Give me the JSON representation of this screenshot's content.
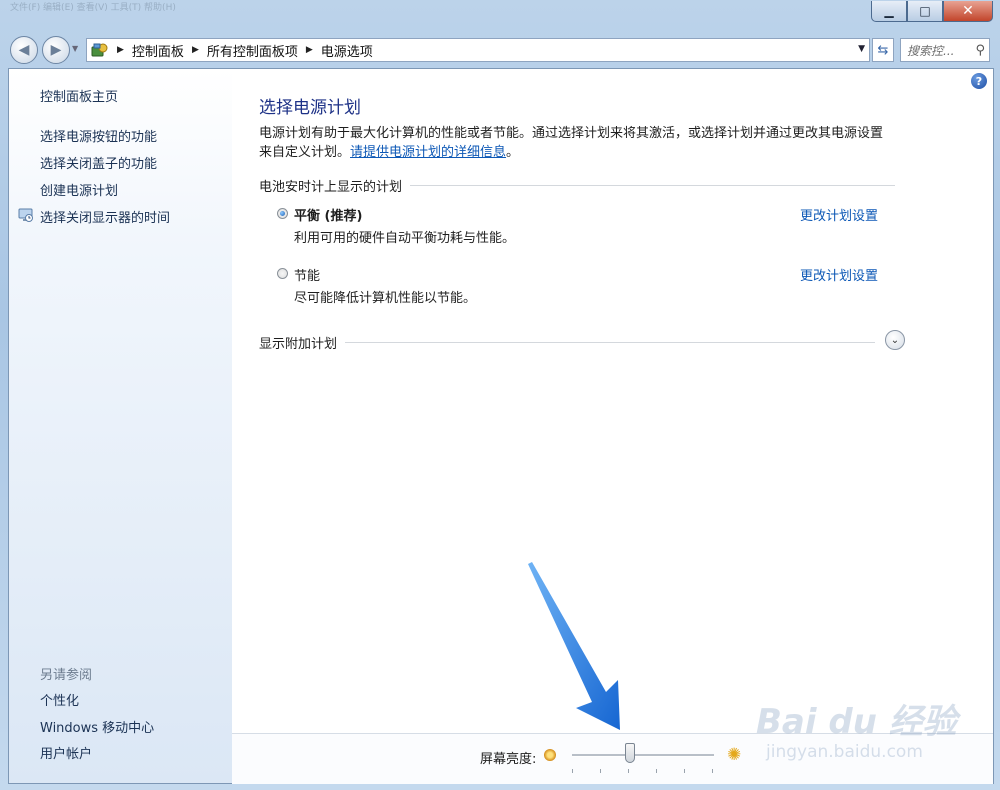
{
  "window": {
    "blurred_title": "文件(F)    编辑(E)    查看(V)    工具(T)    帮助(H)",
    "minimize_glyph": "▁",
    "maximize_glyph": "□",
    "close_glyph": "✕"
  },
  "navbar": {
    "back_glyph": "◀",
    "forward_glyph": "▶",
    "recent_glyph": "▼",
    "breadcrumb": [
      "控制面板",
      "所有控制面板项",
      "电源选项"
    ],
    "separator": "▶",
    "dropdown_glyph": "▼",
    "refresh_glyph": "⇆",
    "search_placeholder": "搜索控...",
    "search_glyph": "⚲"
  },
  "sidebar": {
    "home": "控制面板主页",
    "items": [
      "选择电源按钮的功能",
      "选择关闭盖子的功能",
      "创建电源计划",
      "选择关闭显示器的时间"
    ],
    "see_also_title": "另请参阅",
    "see_also": [
      "个性化",
      "Windows 移动中心",
      "用户帐户"
    ]
  },
  "main": {
    "help_glyph": "?",
    "title": "选择电源计划",
    "description_line1": "电源计划有助于最大化计算机的性能或者节能。通过选择计划来将其激活，或选择计划并通过更改其电源设置",
    "description_line2_prefix": "来自定义计划。",
    "description_link": "请提供电源计划的详细信息",
    "description_suffix": "。",
    "group_header": "电池安时计上显示的计划",
    "plans": [
      {
        "name": "平衡 (推荐)",
        "description": "利用可用的硬件自动平衡功耗与性能。",
        "selected": true,
        "change_label": "更改计划设置"
      },
      {
        "name": "节能",
        "description": "尽可能降低计算机性能以节能。",
        "selected": false,
        "change_label": "更改计划设置"
      }
    ],
    "additional_plans": "显示附加计划",
    "expand_glyph": "⌄"
  },
  "bottombar": {
    "brightness_label": "屏幕亮度:",
    "brightness_level": 0.41,
    "sun_glyph": "✺"
  },
  "watermark": {
    "text": "Bai du 经验",
    "url": "jingyan.baidu.com"
  },
  "colors": {
    "link": "#0d58b6",
    "title": "#1e3287",
    "sidebar_link": "#1b3254",
    "arrow": "#1f7ee6"
  }
}
